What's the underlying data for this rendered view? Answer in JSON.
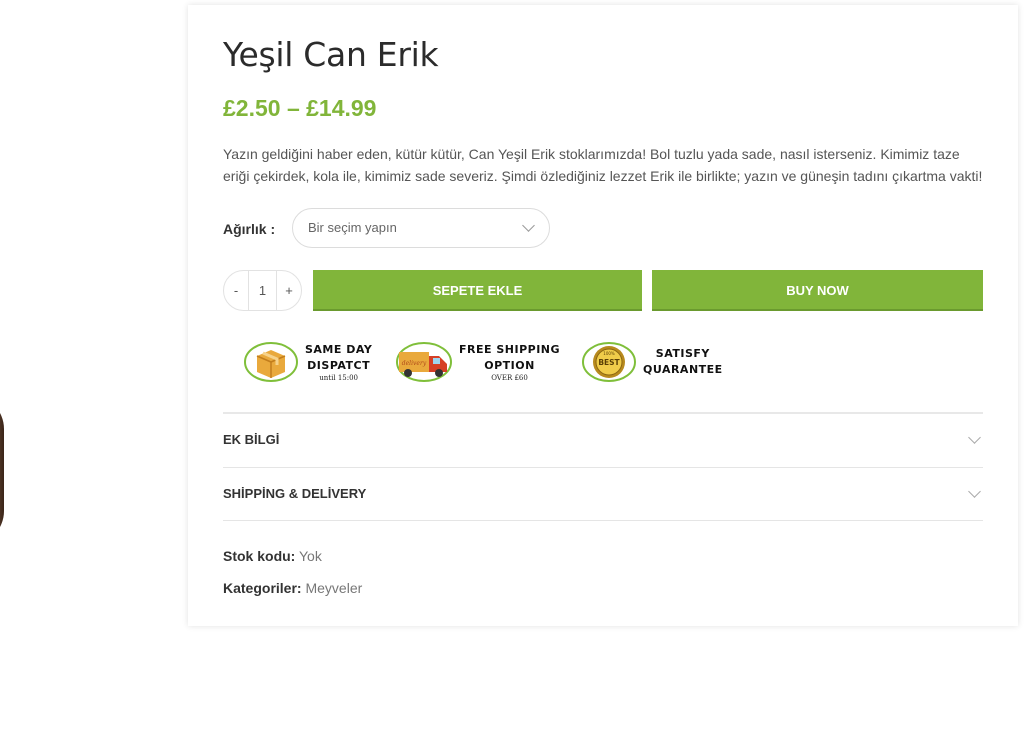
{
  "product": {
    "title": "Yeşil Can Erik",
    "price": "£2.50 – £14.99",
    "description": "Yazın geldiğini haber eden, kütür kütür, Can Yeşil Erik stoklarımızda! Bol tuzlu yada sade, nasıl isterseniz. Kimimiz taze eriği çekirdek, kola ile, kimimiz sade severiz. Şimdi özlediğiniz lezzet Erik ile birlikte; yazın ve güneşin tadını çıkartma vakti!"
  },
  "variation": {
    "label": "Ağırlık",
    "placeholder": "Bir seçim yapın"
  },
  "quantity": {
    "minus": "-",
    "value": "1",
    "plus": "+"
  },
  "buttons": {
    "add_to_cart": "SEPETE EKLE",
    "buy_now": "BUY NOW"
  },
  "badges": [
    {
      "line1": "SAME DAY",
      "line2": "DISPATCT",
      "sub": "until 15:00",
      "icon": "box-icon"
    },
    {
      "line1": "FREE SHIPPING",
      "line2": "OPTION",
      "sub": "OVER £60",
      "icon": "delivery-truck-icon"
    },
    {
      "line1": "SATISFY",
      "line2": "QUARANTEE",
      "sub": "",
      "icon": "best-medal-icon"
    }
  ],
  "accordion": [
    {
      "label": "EK BİLGİ"
    },
    {
      "label": "SHİPPİNG & DELİVERY"
    }
  ],
  "meta": {
    "sku_label": "Stok kodu:",
    "sku_value": "Yok",
    "category_label": "Kategoriler:",
    "category_value": "Meyveler"
  },
  "colors": {
    "accent": "#81b53a",
    "text": "#333333"
  }
}
